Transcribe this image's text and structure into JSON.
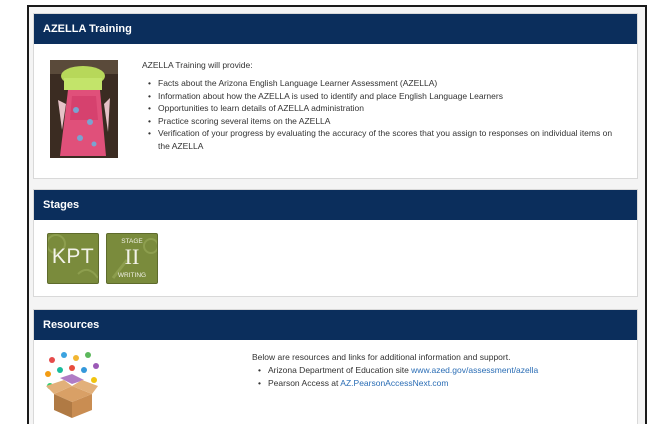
{
  "training": {
    "header": "AZELLA Training",
    "intro": "AZELLA Training will provide:",
    "bullets": [
      "Facts about the Arizona English Language Learner Assessment (AZELLA)",
      "Information about how the AZELLA is used to identify and place English Language Learners",
      "Opportunities to learn details of AZELLA administration",
      "Practice scoring several items on the AZELLA",
      "Verification of your progress by evaluating the accuracy of the scores that you assign to responses on individual items on the AZELLA"
    ]
  },
  "stages": {
    "header": "Stages",
    "kpt_label": "KPT",
    "stage2_top": "STAGE",
    "stage2_num": "II",
    "stage2_bottom": "WRITING"
  },
  "resources": {
    "header": "Resources",
    "intro": "Below are resources and links for additional information and support.",
    "items": [
      {
        "prefix": "Arizona Department of Education site ",
        "link": "www.azed.gov/assessment/azella"
      },
      {
        "prefix": "Pearson Access at ",
        "link": "AZ.PearsonAccessNext.com"
      }
    ]
  },
  "colors": {
    "header_bg": "#0b2e5c",
    "stage_button": "#7a8b3c",
    "link": "#2a6db5"
  }
}
